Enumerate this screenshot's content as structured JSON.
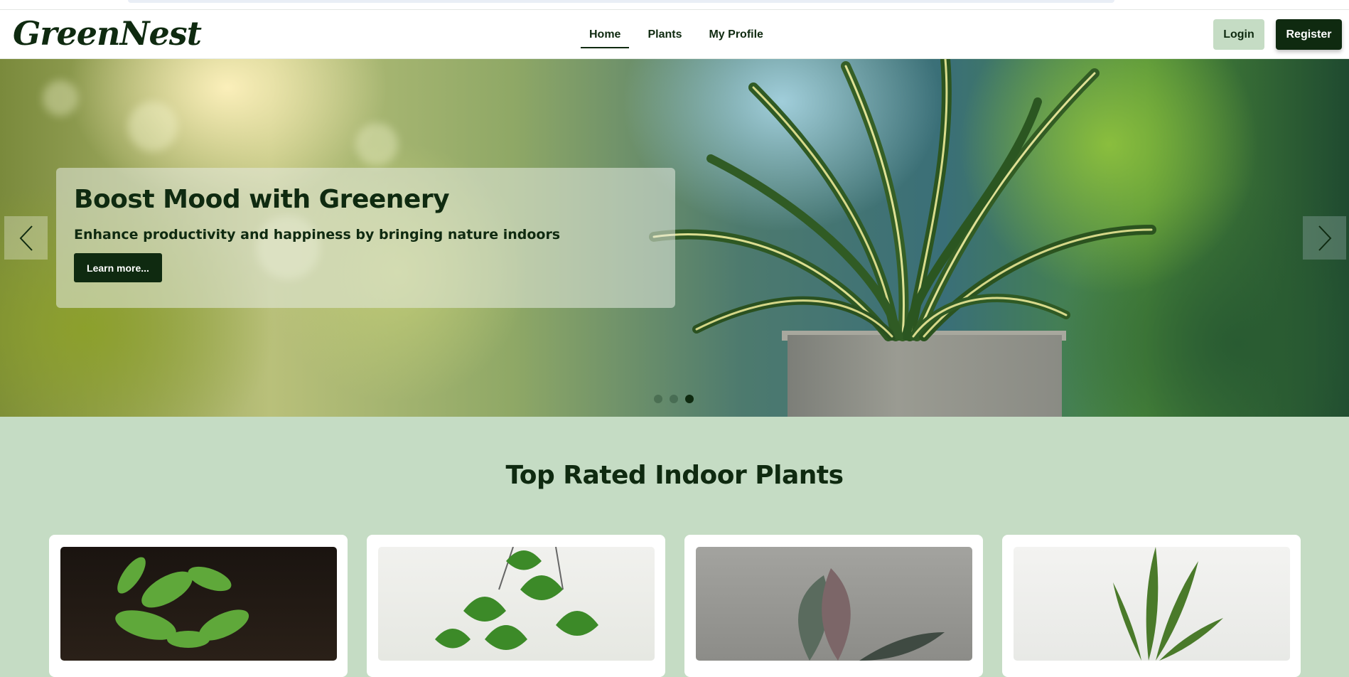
{
  "brand": {
    "logo": "GreenNest"
  },
  "nav": {
    "links": [
      {
        "label": "Home",
        "active": true
      },
      {
        "label": "Plants",
        "active": false
      },
      {
        "label": "My Profile",
        "active": false
      }
    ],
    "login_label": "Login",
    "register_label": "Register"
  },
  "hero": {
    "title": "Boost Mood with Greenery",
    "subtitle": "Enhance productivity and happiness by bringing nature indoors",
    "cta_label": "Learn more...",
    "prev_icon": "chevron-left-icon",
    "next_icon": "chevron-right-icon",
    "slides_count": 3,
    "active_slide": 3
  },
  "section": {
    "title": "Top Rated Indoor Plants"
  },
  "cards": [
    {
      "image": "jade-plant-photo"
    },
    {
      "image": "philodendron-hanging-photo"
    },
    {
      "image": "rubber-plant-photo"
    },
    {
      "image": "snake-plant-photo"
    }
  ],
  "colors": {
    "primary_dark": "#0f2a10",
    "accent_light": "#c5dcc4",
    "white": "#ffffff"
  }
}
